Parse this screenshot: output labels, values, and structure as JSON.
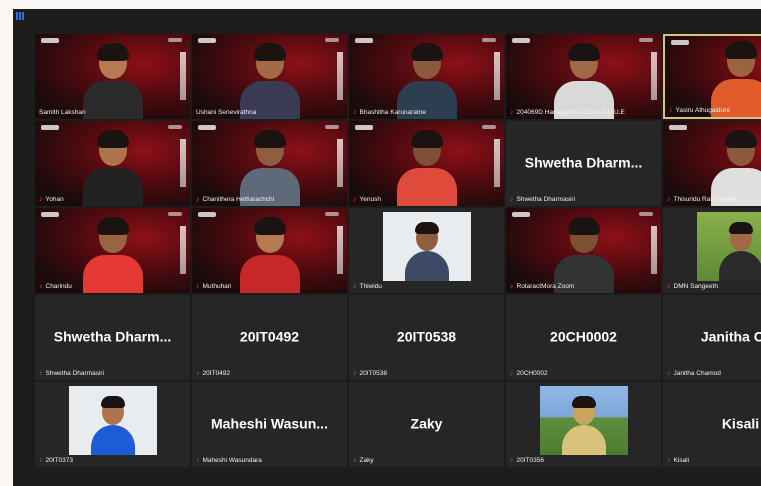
{
  "meeting": {
    "participants": [
      {
        "name": "Samith Lakshan",
        "muted": false,
        "type": "video",
        "active": false
      },
      {
        "name": "Ushani Senevirathna",
        "muted": false,
        "type": "video",
        "active": false
      },
      {
        "name": "Bhashitha Karunaratne",
        "muted": true,
        "type": "video",
        "active": false
      },
      {
        "name": "204069D Harisagama D.E.M.A.U.U.E",
        "muted": true,
        "type": "video",
        "active": false
      },
      {
        "name": "Yasiru Athugaldure",
        "muted": true,
        "type": "video",
        "active": true
      },
      {
        "name": "Yohan",
        "muted": true,
        "type": "video",
        "active": false
      },
      {
        "name": "Chanithera Hettiarachchi",
        "muted": true,
        "type": "video",
        "active": false
      },
      {
        "name": "Yenush",
        "muted": true,
        "type": "video",
        "active": false
      },
      {
        "name": "Shwetha Dharmasiri",
        "display": "Shwetha  Dharm...",
        "muted": true,
        "type": "name",
        "active": false
      },
      {
        "name": "Thisuridu Rathnayake",
        "muted": true,
        "type": "video",
        "active": false
      },
      {
        "name": "Charindu",
        "muted": true,
        "type": "video",
        "active": false
      },
      {
        "name": "Muthuhari",
        "muted": true,
        "type": "video",
        "active": false
      },
      {
        "name": "Thiwidu",
        "muted": true,
        "type": "photo",
        "active": false
      },
      {
        "name": "RotaractMora Zoom",
        "muted": true,
        "type": "video",
        "active": false
      },
      {
        "name": "DMN Sangeeth",
        "muted": true,
        "type": "photo",
        "active": false
      },
      {
        "name": "Shwetha Dharmasiri",
        "display": "Shwetha  Dharm...",
        "muted": true,
        "type": "name",
        "active": false
      },
      {
        "name": "20IT0492",
        "display": "20IT0492",
        "muted": true,
        "type": "name",
        "active": false
      },
      {
        "name": "20IT0538",
        "display": "20IT0538",
        "muted": true,
        "type": "name",
        "active": false
      },
      {
        "name": "20CH0002",
        "display": "20CH0002",
        "muted": true,
        "type": "name",
        "active": false
      },
      {
        "name": "Janitha Chamod",
        "display": "Janitha Cha",
        "muted": true,
        "type": "name",
        "active": false
      },
      {
        "name": "20IT0373",
        "muted": true,
        "type": "photo",
        "active": false
      },
      {
        "name": "Maheshi Wasundara",
        "display": "Maheshi  Wasun...",
        "muted": true,
        "type": "name",
        "active": false
      },
      {
        "name": "Zaky",
        "display": "Zaky",
        "muted": true,
        "type": "name",
        "active": false
      },
      {
        "name": "20IT0356",
        "muted": true,
        "type": "photo",
        "active": false
      },
      {
        "name": "Kisali",
        "display": "Kisali",
        "muted": true,
        "type": "name",
        "active": false
      }
    ]
  },
  "icons": {
    "muted": "mic-muted-icon",
    "menu": "grid-menu-icon"
  },
  "colors": {
    "muted_mic": "#ff3b3b",
    "active_border": "#d9c27a",
    "backdrop": "#8e1018"
  }
}
